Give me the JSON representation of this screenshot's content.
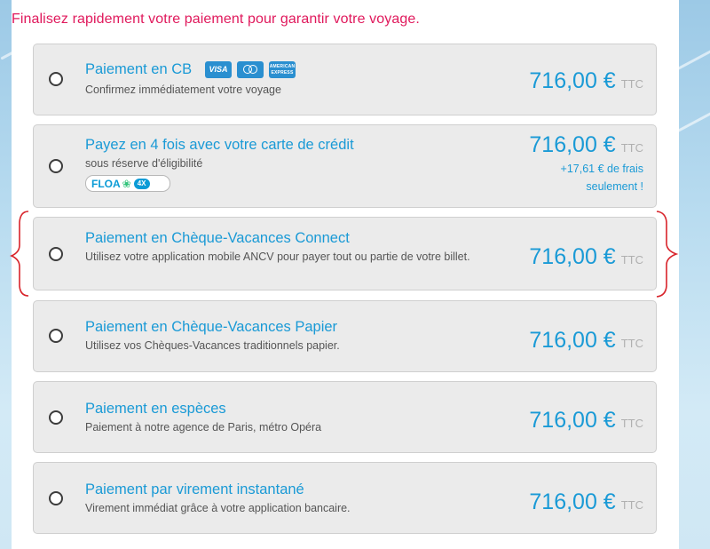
{
  "heading": "Finalisez rapidement votre paiement pour garantir votre voyage.",
  "currency_suffix": "TTC",
  "accent_color": "#1a9ad6",
  "heading_color": "#e0195c",
  "options": [
    {
      "title": "Paiement en CB",
      "description": "Confirmez immédiatement votre voyage",
      "price": "716,00 €",
      "card_logos": [
        "visa-icon",
        "mastercard-icon",
        "amex-icon"
      ],
      "logo_texts": {
        "visa": "VISA",
        "amex": "AMERICAN EXPRESS"
      },
      "selected": false
    },
    {
      "title": "Payez en 4 fois avec votre carte de crédit",
      "description": "sous réserve d'éligibilité",
      "price": "716,00 €",
      "fee_line1": "+17,61 € de frais",
      "fee_line2": "seulement !",
      "badge": {
        "brand": "FLOA",
        "tag": "4X"
      },
      "selected": false
    },
    {
      "title": "Paiement en Chèque-Vacances Connect",
      "description": "Utilisez votre application mobile ANCV pour payer tout ou partie de votre billet.",
      "price": "716,00 €",
      "selected": false,
      "highlighted": true
    },
    {
      "title": "Paiement en Chèque-Vacances Papier",
      "description": "Utilisez vos Chèques-Vacances traditionnels papier.",
      "price": "716,00 €",
      "selected": false
    },
    {
      "title": "Paiement en espèces",
      "description": "Paiement à notre agence de Paris, métro Opéra",
      "price": "716,00 €",
      "selected": false
    },
    {
      "title": "Paiement par virement instantané",
      "description": "Virement immédiat grâce à votre application bancaire.",
      "price": "716,00 €",
      "selected": false
    }
  ]
}
